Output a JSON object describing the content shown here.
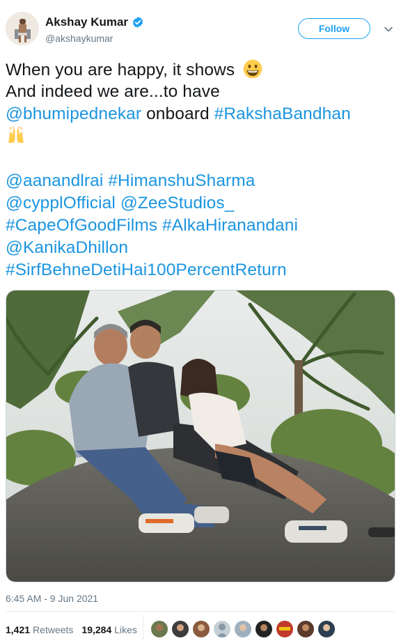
{
  "author": {
    "display_name": "Akshay Kumar",
    "handle": "@akshaykumar",
    "verified_icon": "verified-badge-icon",
    "accent_color": "#1da1f2"
  },
  "follow_label": "Follow",
  "tweet": {
    "line1": "When you are happy, it shows ",
    "line2": "And indeed we are...to have",
    "mention_bhumi": "@bhumipednekar",
    "onboard": " onboard ",
    "tag_raksha": "#RakshaBandhan",
    "mention_aanand": "@aanandlrai",
    "tag_himanshu": "#HimanshuSharma",
    "mention_cyppl": "@cypplOfficial",
    "mention_zee": "@ZeeStudios_",
    "tag_cape": "#CapeOfGoodFilms",
    "tag_alka": "#AlkaHiranandani",
    "mention_kanika": "@KanikaDhillon",
    "tag_sirf": "#SirfBehneDetiHai100PercentReturn",
    "link_color": "#1b95e0"
  },
  "photo_label": "Photo of three people sitting on a stone ledge among palm trees",
  "timestamp": "6:45 AM - 9 Jun 2021",
  "stats": {
    "retweets_count": "1,421",
    "retweets_label": "Retweets",
    "likes_count": "19,284",
    "likes_label": "Likes"
  }
}
